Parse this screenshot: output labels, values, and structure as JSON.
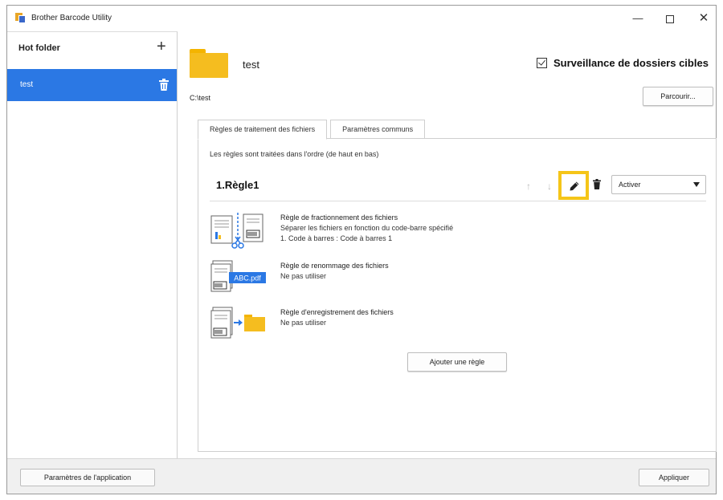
{
  "window": {
    "title": "Brother Barcode Utility",
    "minimize": "—",
    "close": "✕"
  },
  "sidebar": {
    "title": "Hot folder",
    "add": "+",
    "items": [
      {
        "label": "test"
      }
    ]
  },
  "main": {
    "folder_name": "test",
    "monitor_label": "Surveillance de dossiers cibles",
    "path": "C:\\test",
    "browse_label": "Parcourir..."
  },
  "tabs": [
    {
      "label": "Règles de traitement des fichiers"
    },
    {
      "label": "Paramètres communs"
    }
  ],
  "panel": {
    "order_note": "Les règles sont traitées dans l'ordre (de haut en bas)",
    "rule": {
      "title": "1.Règle1",
      "up": "↑",
      "down": "↓",
      "status_value": "Activer"
    },
    "entries": [
      {
        "title": "Règle de fractionnement des fichiers",
        "line2": "Séparer les fichiers en fonction du code-barre spécifié",
        "line3": "1. Code à barres : Code à barres 1"
      },
      {
        "title": "Règle de renommage des fichiers",
        "line2": "Ne pas utiliser",
        "badge": "ABC.pdf"
      },
      {
        "title": "Règle d'enregistrement des fichiers",
        "line2": "Ne pas utiliser"
      }
    ],
    "add_rule_label": "Ajouter une règle"
  },
  "footer": {
    "app_settings_label": "Paramètres de l'application",
    "apply_label": "Appliquer"
  },
  "colors": {
    "accent_blue": "#2b78e4",
    "folder_yellow": "#f5bd1f",
    "highlight_yellow": "#f5c518"
  }
}
